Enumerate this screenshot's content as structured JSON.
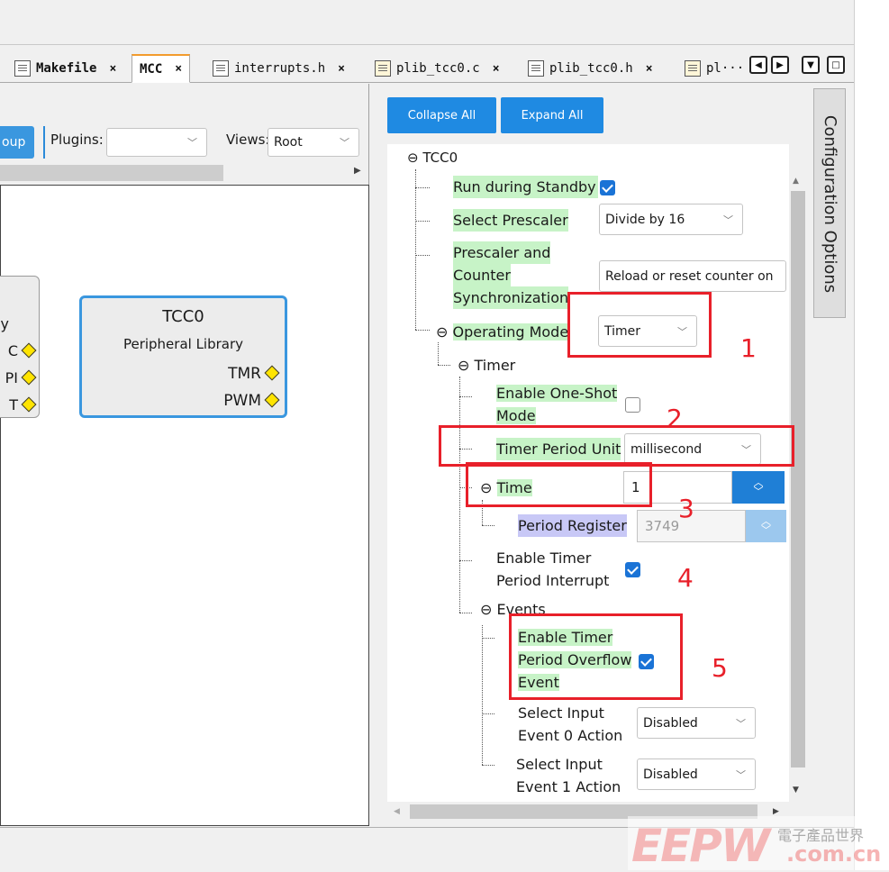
{
  "tabs": [
    {
      "label": "Makefile",
      "close": "×"
    },
    {
      "label": "MCC",
      "close": "×"
    },
    {
      "label": "interrupts.h",
      "close": "×"
    },
    {
      "label": "plib_tcc0.c",
      "close": "×"
    },
    {
      "label": "plib_tcc0.h",
      "close": "×"
    },
    {
      "label": "pl···"
    }
  ],
  "left": {
    "group_btn": "oup",
    "plugins_label": "Plugins:",
    "views_label": "Views:",
    "views_value": "Root",
    "partial_block_lines": [
      "y",
      "C",
      "PI",
      "T"
    ],
    "tcc_block": {
      "title": "TCC0",
      "subtitle": "Peripheral Library",
      "ports": [
        "TMR",
        "PWM"
      ]
    }
  },
  "right": {
    "collapse_all": "Collapse All",
    "expand_all": "Expand All",
    "side_tab": "Configuration Options",
    "root": "TCC0",
    "run_standby": "Run during Standby",
    "select_prescaler": "Select Prescaler",
    "prescaler_value": "Divide by 16",
    "presync_line1": "Prescaler and",
    "presync_line2": "Counter",
    "presync_line3": "Synchronization",
    "presync_value": "Reload or reset counter on",
    "operating_mode": "Operating Mode",
    "operating_mode_value": "Timer",
    "timer_node": "Timer",
    "oneshot_line1": "Enable One-Shot",
    "oneshot_line2": "Mode",
    "period_unit": "Timer Period Unit",
    "period_unit_value": "millisecond",
    "time": "Time",
    "time_value": "1",
    "period_register": "Period Register",
    "period_register_value": "3749",
    "period_int_line1": "Enable Timer",
    "period_int_line2": "Period Interrupt",
    "events": "Events",
    "ovf_line1": "Enable Timer",
    "ovf_line2": "Period Overflow",
    "ovf_line3": "Event",
    "evt0_line1": "Select Input",
    "evt0_line2": "Event 0 Action",
    "evt0_value": "Disabled",
    "evt1_line1": "Select Input",
    "evt1_line2": "Event 1 Action",
    "evt1_value": "Disabled",
    "collapse_glyph": "⊖"
  },
  "annotations": [
    "1",
    "2",
    "3",
    "4",
    "5"
  ],
  "watermark": {
    "brand": "EEPW",
    "cn": "電子產品世界",
    "domain": ".com.cn"
  },
  "colors": {
    "accent_blue": "#1f8ae2",
    "highlight_green": "#c7f3c7",
    "highlight_purple": "#c8c8f6",
    "annotation_red": "#e8202a"
  }
}
